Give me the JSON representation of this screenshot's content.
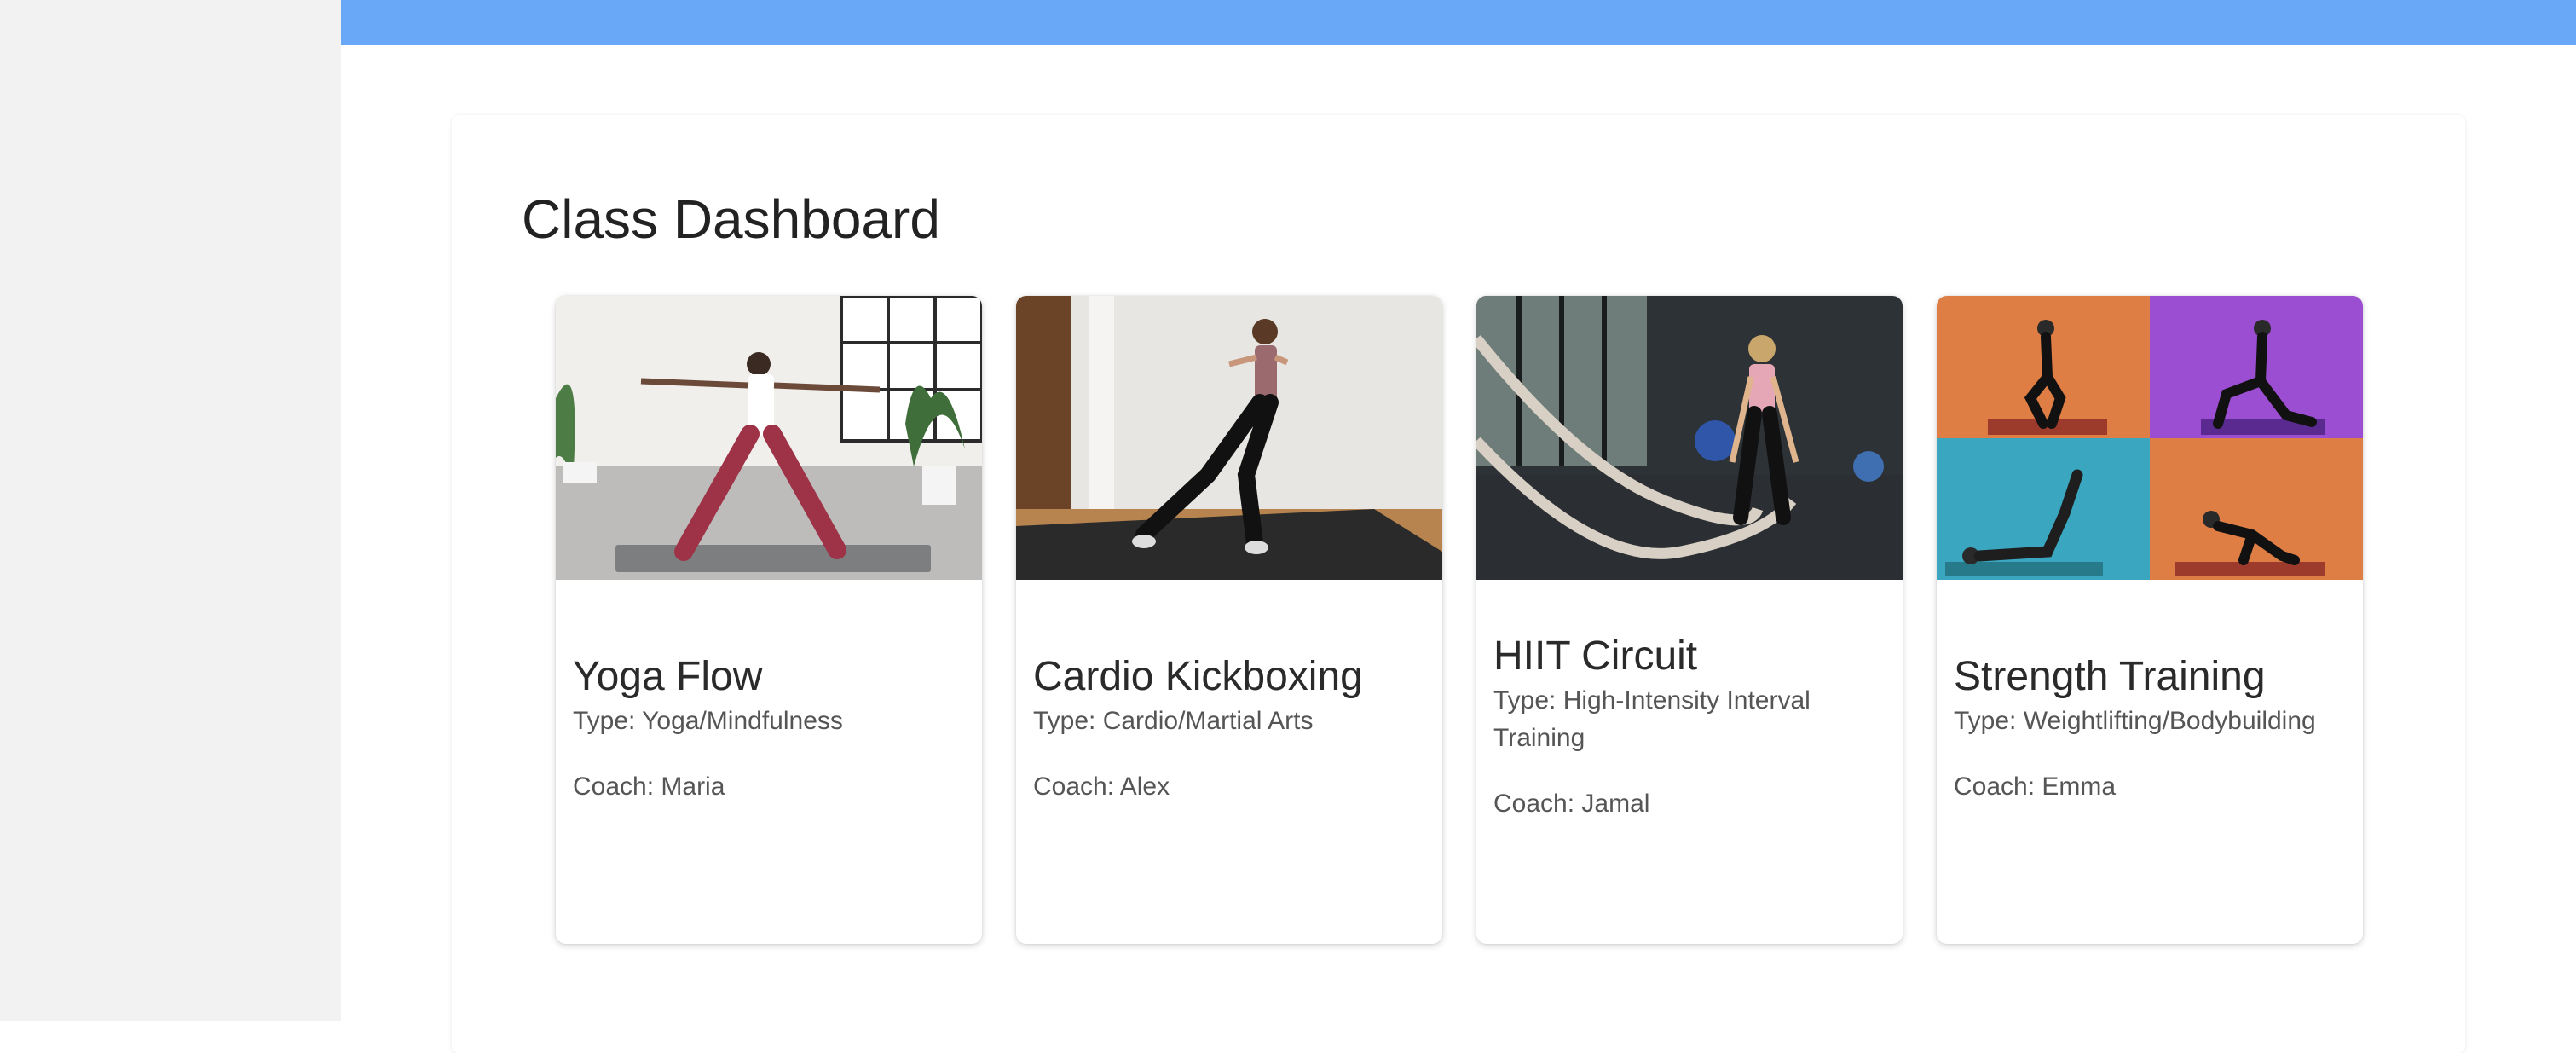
{
  "page": {
    "title": "Class Dashboard"
  },
  "colors": {
    "topbar": "#68a8f7",
    "sidebar": "#f2f2f2"
  },
  "classes": [
    {
      "name": "Yoga Flow",
      "type": "Type: Yoga/Mindfulness",
      "coach": "Coach: Maria",
      "image_icon": "yoga-pose-image"
    },
    {
      "name": "Cardio Kickboxing",
      "type": "Type: Cardio/Martial Arts",
      "coach": "Coach: Alex",
      "image_icon": "kickboxing-image"
    },
    {
      "name": "HIIT Circuit",
      "type": "Type: High-Intensity Interval Training",
      "coach": "Coach: Jamal",
      "image_icon": "battle-ropes-image"
    },
    {
      "name": "Strength Training",
      "type": "Type: Weightlifting/Bodybuilding",
      "coach": "Coach: Emma",
      "image_icon": "strength-grid-image"
    }
  ]
}
